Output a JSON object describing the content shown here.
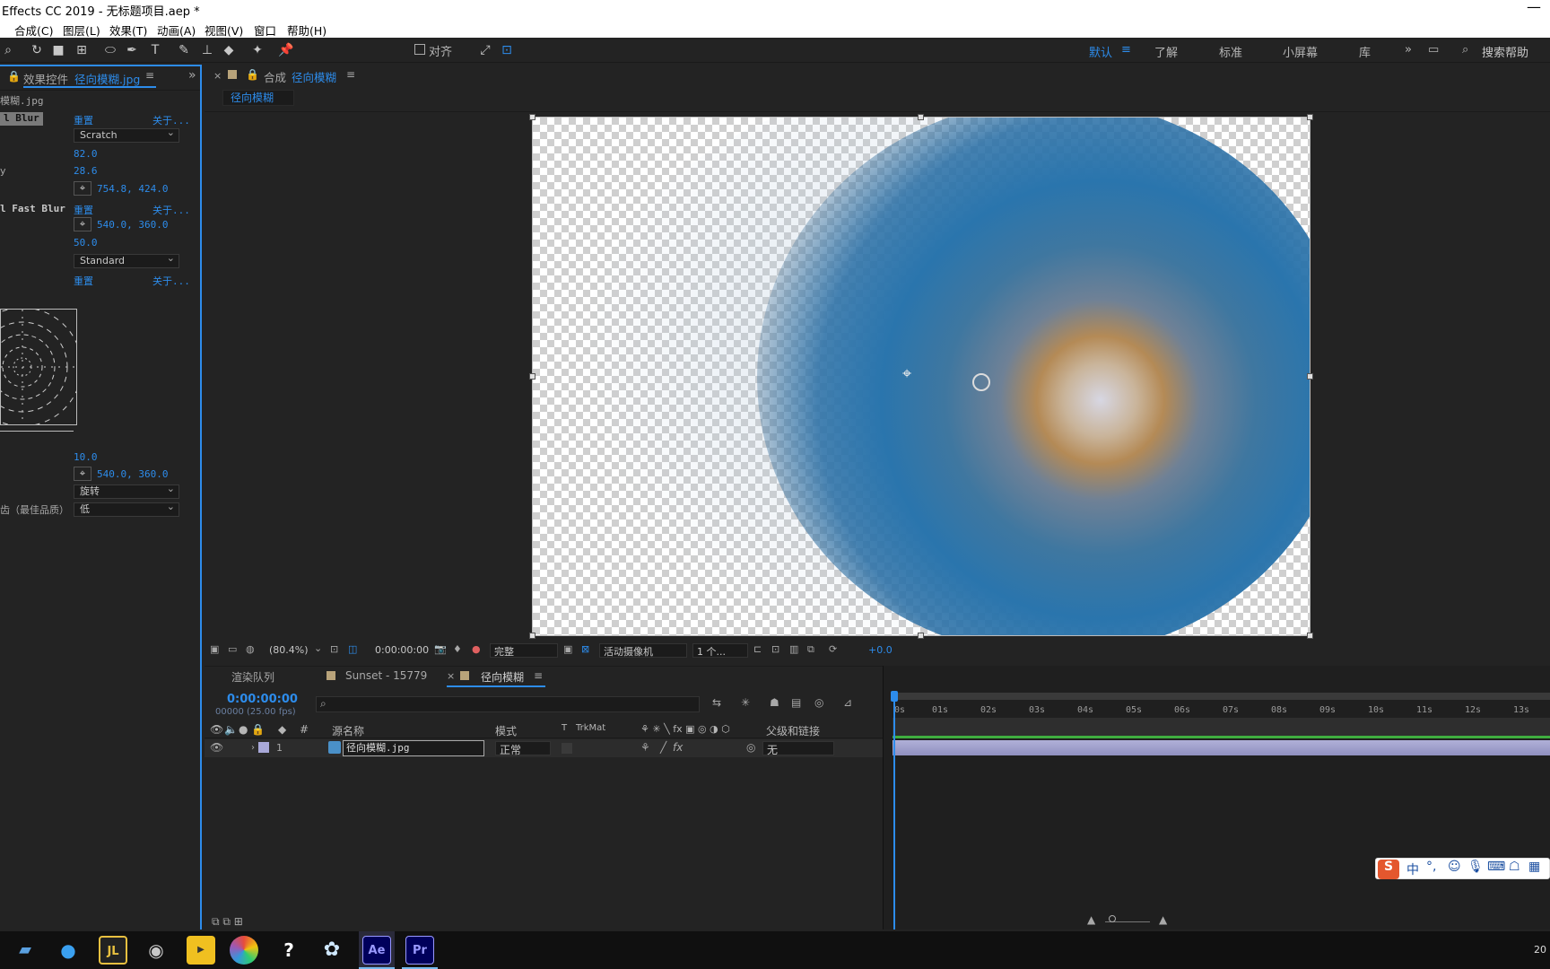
{
  "window": {
    "title": "Effects CC 2019 - 无标题项目.aep *"
  },
  "menu": {
    "items": [
      "合成(C)",
      "图层(L)",
      "效果(T)",
      "动画(A)",
      "视图(V)",
      "窗口",
      "帮助(H)"
    ]
  },
  "toolbar": {
    "align_label": "对齐",
    "workspaces": [
      "默认",
      "了解",
      "标准",
      "小屏幕",
      "库"
    ],
    "active_workspace": "默认",
    "search_placeholder": "搜索帮助"
  },
  "effects_panel": {
    "tab_prefix": "效果控件",
    "tab_file": "径向模糊.jpg",
    "layer_label": "模糊.jpg",
    "effect1": {
      "name": "l Blur",
      "reset": "重置",
      "about": "关于...",
      "type": "Scratch",
      "amount": "82.0",
      "field3": "28.6",
      "center": "754.8, 424.0"
    },
    "effect2": {
      "name": "l Fast Blur",
      "reset": "重置",
      "about": "关于...",
      "center": "540.0, 360.0",
      "amount": "50.0",
      "quality": "Standard"
    },
    "effect3": {
      "reset": "重置",
      "about": "关于...",
      "amount": "10.0",
      "center": "540.0, 360.0",
      "type": "旋转",
      "antialias_label": "齿（最佳品质）",
      "antialias_value": "低"
    },
    "row_label_y": "y"
  },
  "comp_panel": {
    "tab_prefix": "合成",
    "tab_name": "径向模糊",
    "subtab": "径向模糊"
  },
  "viewer_bar": {
    "zoom": "(80.4%)",
    "timecode": "0:00:00:00",
    "resolution": "完整",
    "camera": "活动摄像机",
    "views": "1 个...",
    "exposure": "+0.0"
  },
  "timeline": {
    "tabs": [
      "渲染队列",
      "Sunset - 15779",
      "径向模糊"
    ],
    "current_time": "0:00:00:00",
    "fps_label": "00000 (25.00 fps)",
    "columns": {
      "num": "#",
      "source": "源名称",
      "mode": "模式",
      "t": "T",
      "trkmat": "TrkMat",
      "parent": "父级和链接"
    },
    "ruler": [
      "0s",
      "01s",
      "02s",
      "03s",
      "04s",
      "05s",
      "06s",
      "07s",
      "08s",
      "09s",
      "10s",
      "11s",
      "12s",
      "13s"
    ],
    "layer": {
      "index": "1",
      "name": "径向模糊.jpg",
      "mode": "正常",
      "parent": "无"
    }
  },
  "ime": {
    "lang": "中"
  },
  "taskbar": {
    "apps": [
      {
        "label": "Ae",
        "color": "#9999ff",
        "bg": "#00005b"
      },
      {
        "label": "Pr",
        "color": "#9999ff",
        "bg": "#00005b"
      }
    ],
    "clock": "20"
  },
  "colors": {
    "accent": "#2d8ceb",
    "panel_bg": "#232323",
    "layer_bar": "#a0a0c8"
  }
}
